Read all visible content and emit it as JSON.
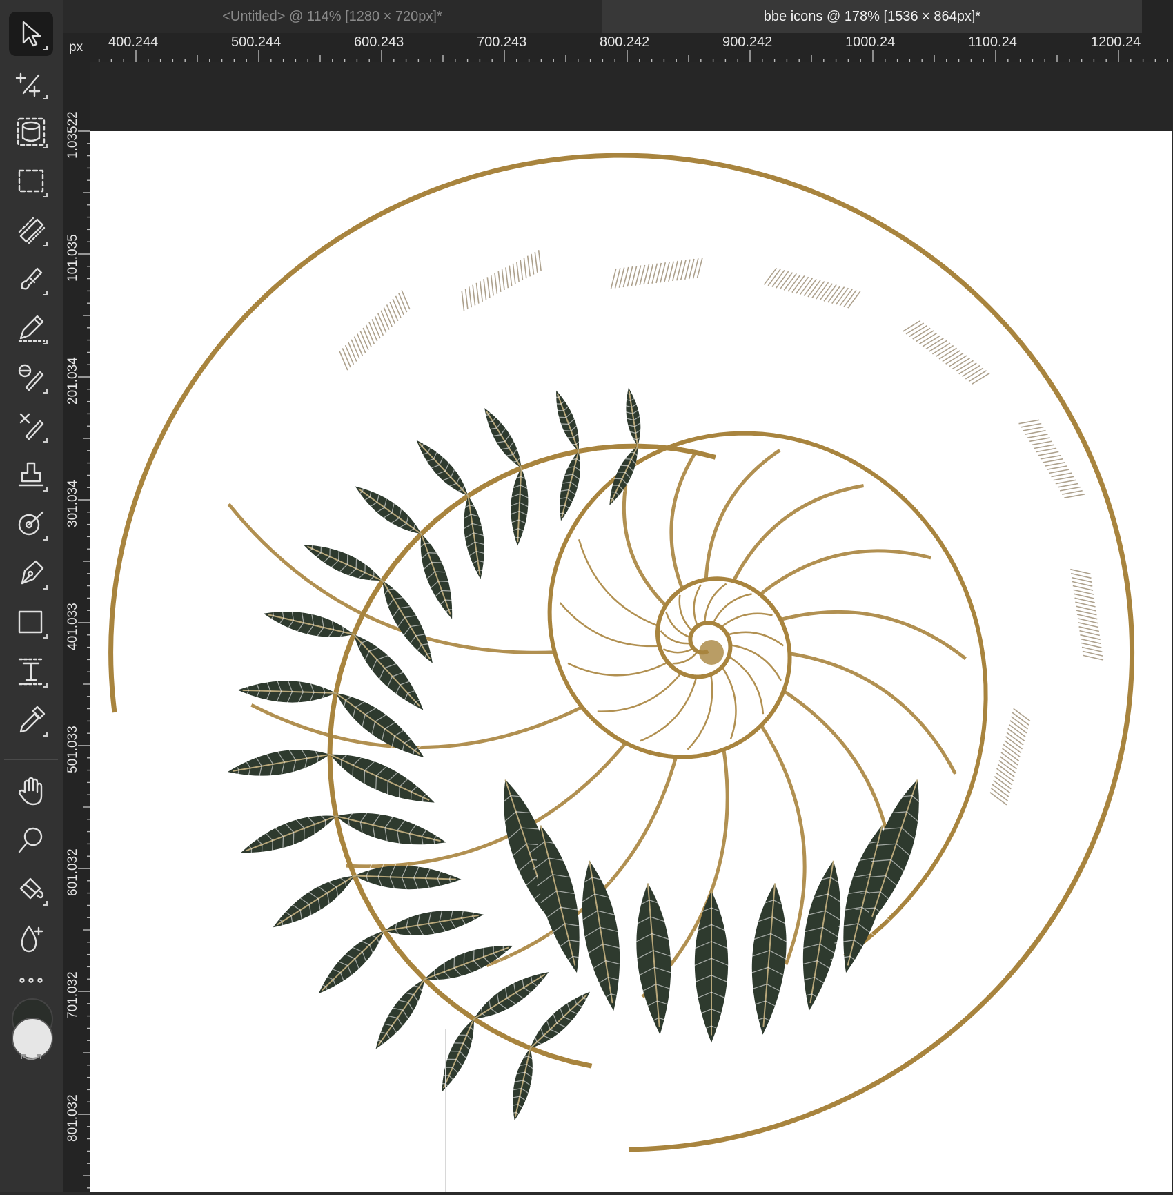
{
  "tabs": [
    {
      "label": "<Untitled> @ 114% [1280 × 720px]*",
      "active": false
    },
    {
      "label": "bbe icons @ 178% [1536 × 864px]*",
      "active": true
    }
  ],
  "ruler": {
    "unit": "px",
    "top_labels": [
      "400.244",
      "500.244",
      "600.243",
      "700.243",
      "800.242",
      "900.242",
      "1000.24",
      "1100.24",
      "1200.24"
    ],
    "left_labels": [
      "1.03522",
      "101.035",
      "201.034",
      "301.034",
      "401.033",
      "501.033",
      "601.032",
      "701.032",
      "801.032"
    ]
  },
  "tools": [
    {
      "name": "move-tool",
      "icon": "cursor-arrow-icon",
      "active": true
    },
    {
      "name": "node-tool",
      "icon": "node-icon"
    },
    {
      "name": "quick-mask-tool",
      "icon": "selection-cylinder-icon"
    },
    {
      "name": "rectangle-marquee-tool",
      "icon": "marquee-icon"
    },
    {
      "name": "flood-select-tool",
      "icon": "brush-select-icon"
    },
    {
      "name": "paint-brush-tool",
      "icon": "brush-icon"
    },
    {
      "name": "pencil-tool",
      "icon": "pencil-icon"
    },
    {
      "name": "dodge-tool",
      "icon": "dodge-icon"
    },
    {
      "name": "clone-brush-tool",
      "icon": "clone-icon"
    },
    {
      "name": "stamp-tool",
      "icon": "stamp-icon"
    },
    {
      "name": "blemish-tool",
      "icon": "blemish-icon"
    },
    {
      "name": "pen-tool",
      "icon": "pen-nib-icon"
    },
    {
      "name": "shape-tool",
      "icon": "rectangle-shape-icon"
    },
    {
      "name": "text-tool",
      "icon": "text-frame-icon"
    },
    {
      "name": "color-picker-tool",
      "icon": "eyedropper-icon"
    },
    {
      "name": "hand-tool",
      "icon": "hand-icon"
    },
    {
      "name": "zoom-tool",
      "icon": "magnifier-icon"
    },
    {
      "name": "fill-tool",
      "icon": "paint-bucket-icon"
    },
    {
      "name": "gradient-tool",
      "icon": "droplet-plus-icon"
    },
    {
      "name": "more-tools",
      "icon": "ellipsis-icon"
    }
  ],
  "colors": {
    "primary": "#2a2e2a",
    "secondary": "#e6e6e6",
    "shell_gold": "#a8843e",
    "fern_green": "#2e3a2e"
  }
}
